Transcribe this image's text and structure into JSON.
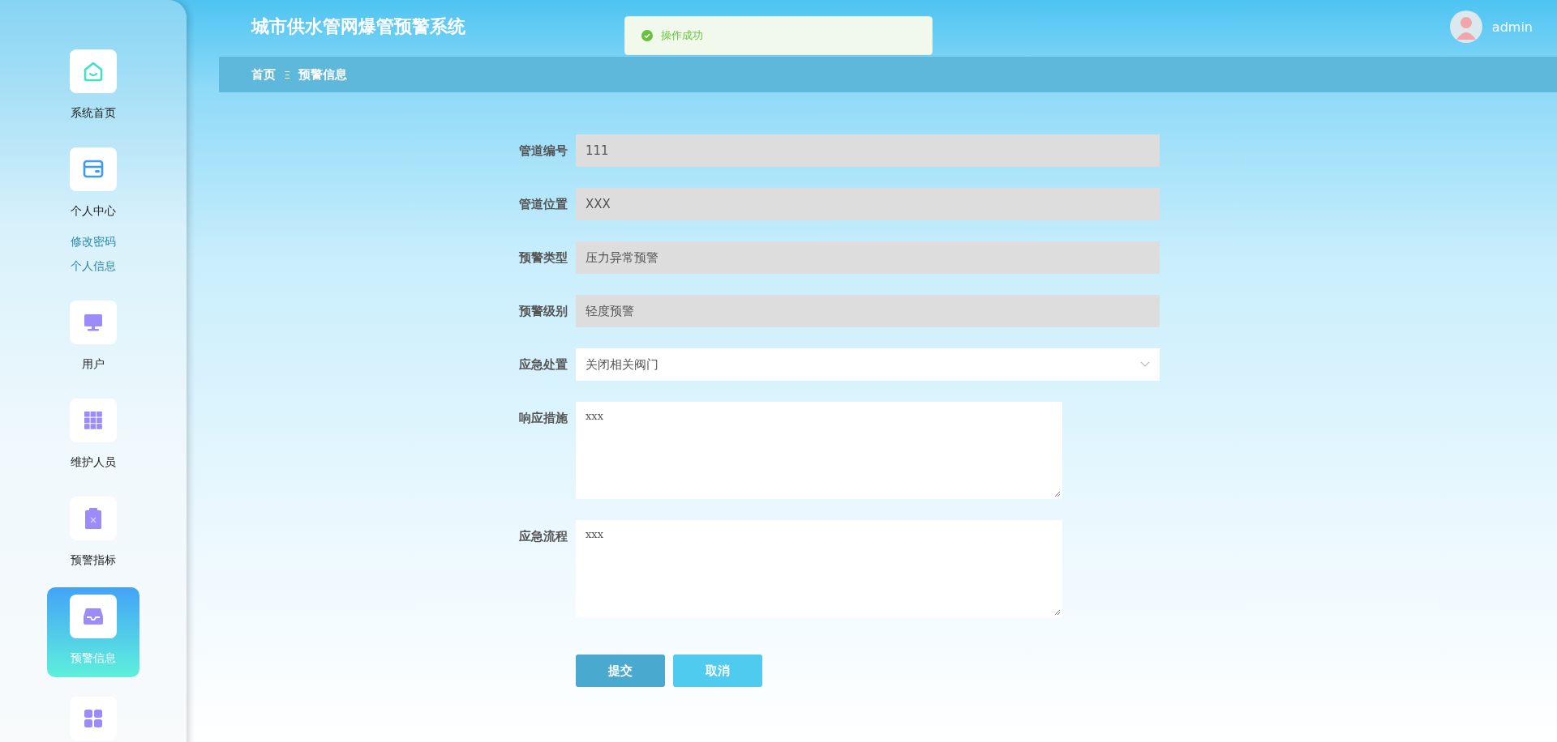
{
  "header": {
    "title": "城市供水管网爆管预警系统",
    "user": "admin"
  },
  "toast": {
    "text": "操作成功"
  },
  "sidebar": {
    "items": [
      {
        "label": "系统首页",
        "selected": false
      },
      {
        "label": "个人中心",
        "selected": false,
        "children": [
          {
            "label": "修改密码"
          },
          {
            "label": "个人信息"
          }
        ]
      },
      {
        "label": "用户",
        "selected": false
      },
      {
        "label": "维护人员",
        "selected": false
      },
      {
        "label": "预警指标",
        "selected": false
      },
      {
        "label": "预警信息",
        "selected": true
      },
      {
        "selected": false
      }
    ]
  },
  "breadcrumb": {
    "items": [
      "首页",
      "预警信息"
    ],
    "separator": "Ξ"
  },
  "form": {
    "fields": [
      {
        "label": "管道编号",
        "kind": "input",
        "value": "111",
        "disabled": true
      },
      {
        "label": "管道位置",
        "kind": "input",
        "value": "XXX",
        "disabled": true
      },
      {
        "label": "预警类型",
        "kind": "input",
        "value": "压力异常预警",
        "disabled": true
      },
      {
        "label": "预警级别",
        "kind": "input",
        "value": "轻度预警",
        "disabled": true
      },
      {
        "label": "应急处置",
        "kind": "select",
        "value": "关闭相关阀门",
        "disabled": false
      },
      {
        "label": "响应措施",
        "kind": "textarea",
        "value": "xxx",
        "disabled": false
      },
      {
        "label": "应急流程",
        "kind": "textarea",
        "value": "xxx",
        "disabled": false
      }
    ],
    "buttons": [
      {
        "label": "提交",
        "kind": "primary"
      },
      {
        "label": "取消",
        "kind": "secondary"
      }
    ]
  }
}
